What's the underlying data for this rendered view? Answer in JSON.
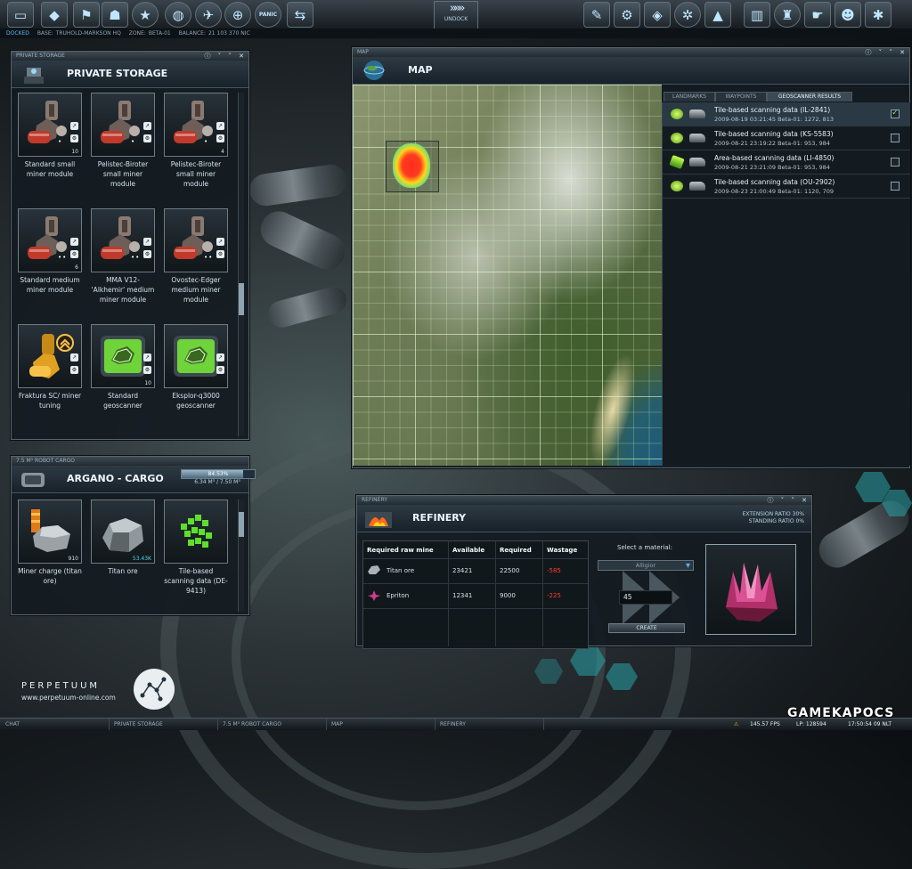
{
  "topbar": {
    "icons": [
      "ship-icon",
      "shield-icon",
      "flag-icon",
      "robot-icon",
      "star-icon",
      "globe-icon",
      "satellite-icon",
      "helmet-icon",
      "panic-icon",
      "swap-icon",
      "assembly-icon",
      "production-icon",
      "terrain-icon",
      "gear-icon",
      "triangle-icon",
      "bars-icon",
      "station-icon",
      "hand-icon",
      "people-icon",
      "cogs-icon"
    ],
    "panic_label": "PANIC",
    "undock_label": "UNDOCK"
  },
  "status": {
    "state": "DOCKED",
    "base_label": "BASE:",
    "base": "TRUHOLD-MARKSON HQ",
    "zone_label": "ZONE:",
    "zone": "BETA-01",
    "balance_label": "BALANCE:",
    "balance": "21 103 370 NIC"
  },
  "storage": {
    "window_title": "PRIVATE STORAGE",
    "heading": "PRIVATE STORAGE",
    "scroll_fraction": 0.45,
    "items": [
      {
        "name": "Standard small miner module",
        "qty": "10",
        "pips": "•",
        "color": "#c0392b"
      },
      {
        "name": "Pelistec-Biroter small miner module",
        "qty": "",
        "pips": "•",
        "color": "#c0392b"
      },
      {
        "name": "Pelistec-Biroter small miner module",
        "qty": "4",
        "pips": "•",
        "color": "#c0392b"
      },
      {
        "name": "Standard medium miner module",
        "qty": "6",
        "pips": "••",
        "color": "#c0392b"
      },
      {
        "name": "MMA V12-'Alkhemir' medium miner module",
        "qty": "",
        "pips": "••",
        "color": "#c0392b"
      },
      {
        "name": "Ovostec-Edger medium miner module",
        "qty": "",
        "pips": "••",
        "color": "#c0392b"
      },
      {
        "name": "Fraktura SC/ miner tuning",
        "qty": "",
        "pips": "",
        "color": "#e0a020"
      },
      {
        "name": "Standard geoscanner",
        "qty": "10",
        "pips": "",
        "color": "#6ed43a"
      },
      {
        "name": "Eksplor-q3000 geoscanner",
        "qty": "",
        "pips": "",
        "color": "#6ed43a"
      }
    ]
  },
  "cargo": {
    "window_title": "7.5 M³ ROBOT CARGO",
    "heading": "ARGANO - CARGO",
    "capacity_percent_label": "84.53%",
    "capacity_fraction": 0.8453,
    "capacity_text": "6.34 M³ / 7.50 M³",
    "items": [
      {
        "name": "Miner charge (titan ore)",
        "qty": "910",
        "qty_teal": false
      },
      {
        "name": "Titan ore",
        "qty": "53.43K",
        "qty_teal": true
      },
      {
        "name": "Tile-based scanning data (DE-9413)",
        "qty": "",
        "qty_teal": false
      }
    ]
  },
  "map": {
    "window_title": "MAP",
    "heading": "MAP",
    "tabs": [
      "LANDMARKS",
      "WAYPOINTS",
      "GEOSCANNER RESULTS"
    ],
    "active_tab": 2,
    "results": [
      {
        "title": "Tile-based scanning data (IL-2841)",
        "sub": "2009-08-19 03:21:45   Beta-01: 1272, 813",
        "checked": true,
        "selected": true,
        "area": false
      },
      {
        "title": "Tile-based scanning data (KS-5583)",
        "sub": "2009-08-21 23:19:22   Beta-01: 953, 984",
        "checked": false,
        "selected": false,
        "area": false
      },
      {
        "title": "Area-based scanning data (LI-4850)",
        "sub": "2009-08-21 23:21:09   Beta-01: 953, 984",
        "checked": false,
        "selected": false,
        "area": true
      },
      {
        "title": "Tile-based scanning data (OU-2902)",
        "sub": "2009-08-23 21:00:49   Beta-01: 1120, 709",
        "checked": false,
        "selected": false,
        "area": false
      }
    ]
  },
  "refinery": {
    "window_title": "REFINERY",
    "heading": "REFINERY",
    "extension_label": "EXTENSION RATIO",
    "extension_value": "30%",
    "standing_label": "STANDING RATIO",
    "standing_value": "0%",
    "columns": [
      "Required raw mine",
      "Available",
      "Required",
      "Wastage"
    ],
    "rows": [
      {
        "name": "Titan ore",
        "available": "23421",
        "required": "22500",
        "wastage": "-585"
      },
      {
        "name": "Epriton",
        "available": "12341",
        "required": "9000",
        "wastage": "-225"
      }
    ],
    "select_label": "Select a material:",
    "selected_material": "Alligior",
    "quantity": "45",
    "create_label": "CREATE"
  },
  "taskbar": {
    "tasks": [
      "CHAT",
      "PRIVATE STORAGE",
      "7.5 M³ ROBOT CARGO",
      "MAP",
      "REFINERY"
    ],
    "fps": "145.57 FPS",
    "lp": "LP: 128594",
    "time": "17:50:54  09 NLT"
  },
  "branding": {
    "logo_word": "PERPETUUM",
    "logo_url": "www.perpetuum-online.com",
    "watermark": "GAMEKAPOCS"
  }
}
